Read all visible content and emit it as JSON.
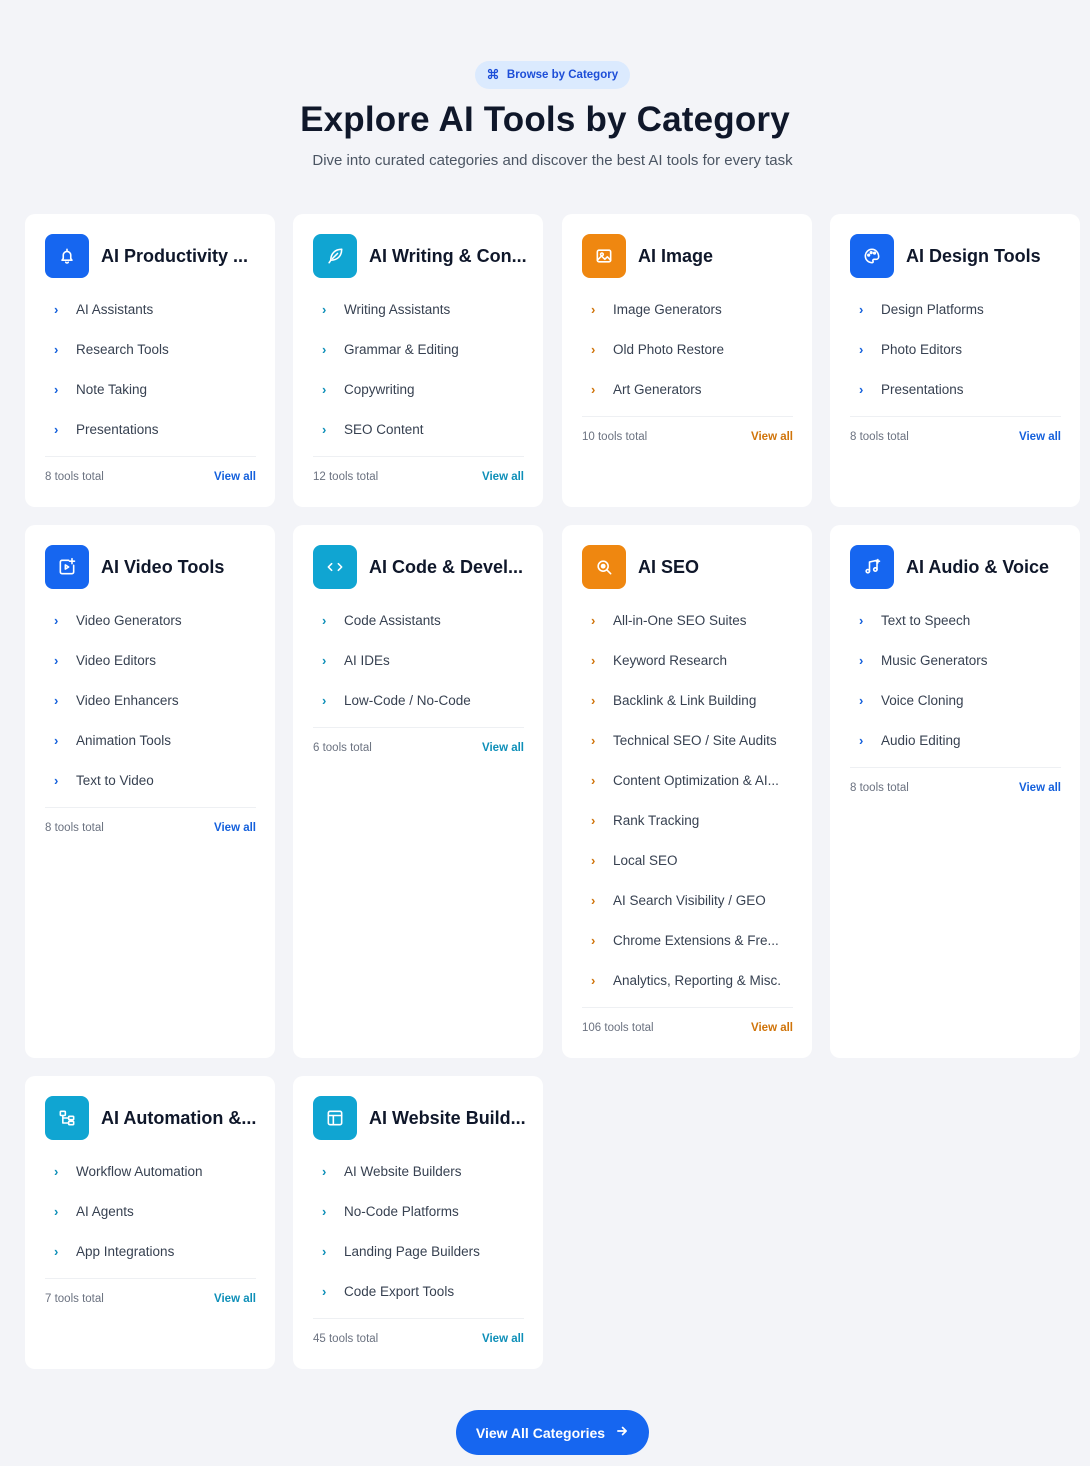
{
  "header": {
    "badge": "Browse by Category",
    "title": "Explore AI Tools by Category",
    "subtitle": "Dive into curated categories and discover the best AI tools for every task"
  },
  "colors": {
    "blue": "#1666f0",
    "cyan": "#10a5d2",
    "orange": "#ef8710",
    "background": "#f3f4f8"
  },
  "cards": [
    {
      "title": "AI Productivity ...",
      "icon": "bell-icon",
      "color": "blue",
      "items": [
        "AI Assistants",
        "Research Tools",
        "Note Taking",
        "Presentations"
      ],
      "count": "8 tools total",
      "link": "View all"
    },
    {
      "title": "AI Writing & Con...",
      "icon": "feather-icon",
      "color": "cyan",
      "items": [
        "Writing Assistants",
        "Grammar & Editing",
        "Copywriting",
        "SEO Content"
      ],
      "count": "12 tools total",
      "link": "View all"
    },
    {
      "title": "AI Image",
      "icon": "image-icon",
      "color": "orange",
      "items": [
        "Image Generators",
        "Old Photo Restore",
        "Art Generators"
      ],
      "count": "10 tools total",
      "link": "View all"
    },
    {
      "title": "AI Design Tools",
      "icon": "palette-icon",
      "color": "blue",
      "items": [
        "Design Platforms",
        "Photo Editors",
        "Presentations"
      ],
      "count": "8 tools total",
      "link": "View all"
    },
    {
      "title": "AI Video Tools",
      "icon": "video-icon",
      "color": "blue",
      "items": [
        "Video Generators",
        "Video Editors",
        "Video Enhancers",
        "Animation Tools",
        "Text to Video"
      ],
      "count": "8 tools total",
      "link": "View all"
    },
    {
      "title": "AI Code & Devel...",
      "icon": "code-icon",
      "color": "cyan",
      "items": [
        "Code Assistants",
        "AI IDEs",
        "Low-Code / No-Code"
      ],
      "count": "6 tools total",
      "link": "View all"
    },
    {
      "title": "AI SEO",
      "icon": "search-icon",
      "color": "orange",
      "items": [
        "All-in-One SEO Suites",
        "Keyword Research",
        "Backlink & Link Building",
        "Technical SEO / Site Audits",
        "Content Optimization & AI...",
        "Rank Tracking",
        "Local SEO",
        "AI Search Visibility / GEO",
        "Chrome Extensions & Fre...",
        "Analytics, Reporting & Misc."
      ],
      "count": "106 tools total",
      "link": "View all"
    },
    {
      "title": "AI Audio & Voice",
      "icon": "music-icon",
      "color": "blue",
      "items": [
        "Text to Speech",
        "Music Generators",
        "Voice Cloning",
        "Audio Editing"
      ],
      "count": "8 tools total",
      "link": "View all"
    },
    {
      "title": "AI Automation &...",
      "icon": "workflow-icon",
      "color": "cyan",
      "items": [
        "Workflow Automation",
        "AI Agents",
        "App Integrations"
      ],
      "count": "7 tools total",
      "link": "View all"
    },
    {
      "title": "AI Website Build...",
      "icon": "layout-icon",
      "color": "cyan",
      "items": [
        "AI Website Builders",
        "No-Code Platforms",
        "Landing Page Builders",
        "Code Export Tools"
      ],
      "count": "45 tools total",
      "link": "View all"
    }
  ],
  "cta": {
    "label": "View All Categories"
  }
}
